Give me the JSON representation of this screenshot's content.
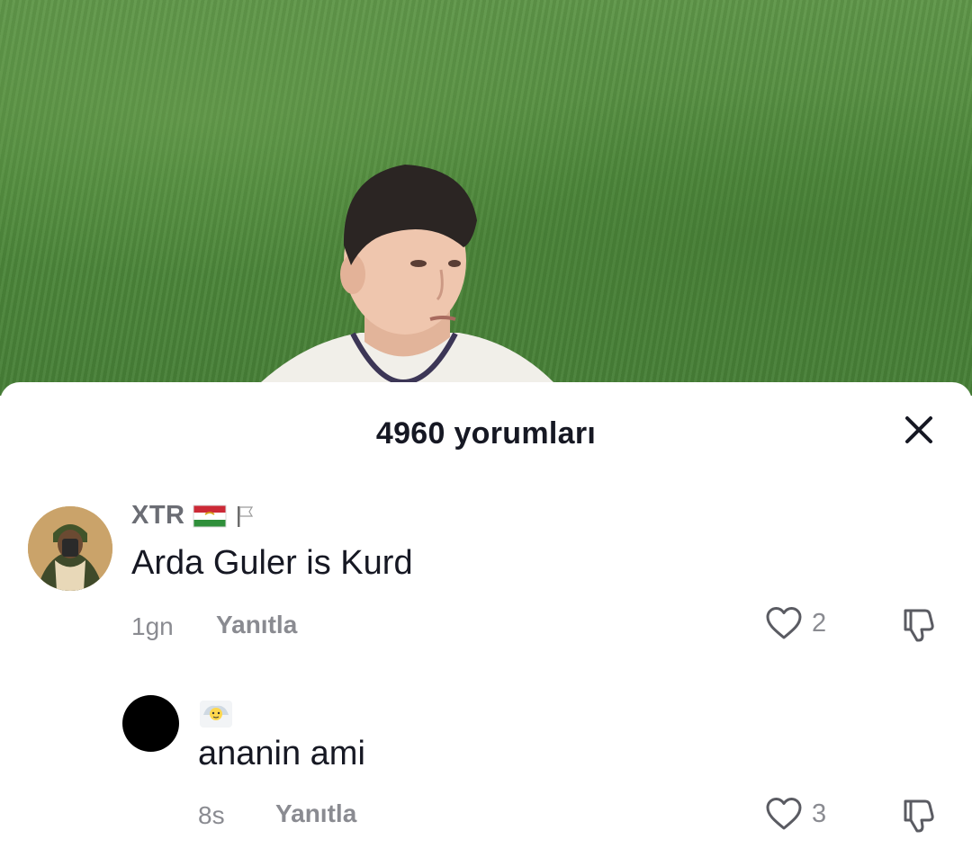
{
  "video": {
    "background_color": "#4f8a3c"
  },
  "comments_sheet": {
    "title": "4960 yorumları",
    "close_icon": "close-icon"
  },
  "comments": [
    {
      "username": "XTR",
      "badges": [
        "tajikistan-flag-icon",
        "white-flag-icon"
      ],
      "text": "Arda Guler is Kurd",
      "time": "1gn",
      "reply_label": "Yanıtla",
      "likes": "2"
    }
  ],
  "replies": [
    {
      "username_badge": "emoji-icon",
      "text": "ananin ami",
      "time": "8s",
      "reply_label": "Yanıtla",
      "likes": "3"
    }
  ],
  "colors": {
    "primary_text": "#161823",
    "secondary_text": "#8a8b91"
  }
}
